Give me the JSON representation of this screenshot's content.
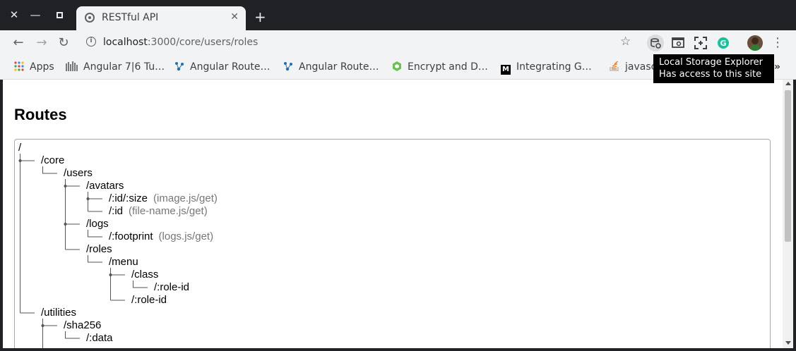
{
  "browser": {
    "window_controls": [
      "close",
      "minimize",
      "maximize"
    ],
    "tab": {
      "title": "RESTful API",
      "close_icon": "close-icon"
    },
    "url": {
      "host": "localhost",
      "rest": ":3000/core/users/roles"
    },
    "extensions": [
      "local-storage-explorer-icon",
      "cast-icon",
      "screenshot-icon",
      "grammarly-icon",
      "profile-avatar"
    ]
  },
  "bookmarks": [
    {
      "label": "Apps",
      "icon": "apps-grid-icon"
    },
    {
      "label": "Angular 7|6 Tu…",
      "icon": "bars-icon"
    },
    {
      "label": "Angular Route…",
      "icon": "route-icon"
    },
    {
      "label": "Angular Route…",
      "icon": "route-icon"
    },
    {
      "label": "Encrypt and D…",
      "icon": "node-hex-icon"
    },
    {
      "label": "Integrating G…",
      "icon": "medium-icon"
    },
    {
      "label": "javasc",
      "icon": "stackoverflow-icon"
    }
  ],
  "bookmarks_overflow": "»",
  "tooltip": {
    "line1": "Local Storage Explorer",
    "line2": "Has access to this site"
  },
  "page": {
    "heading": "Routes"
  },
  "routes": [
    {
      "path": "/",
      "handler": ""
    },
    {
      "path": "/core",
      "handler": ""
    },
    {
      "path": "/users",
      "handler": ""
    },
    {
      "path": "/avatars",
      "handler": ""
    },
    {
      "path": "/:id/:size",
      "handler": "(image.js/get)"
    },
    {
      "path": "/:id",
      "handler": "(file-name.js/get)"
    },
    {
      "path": "/logs",
      "handler": ""
    },
    {
      "path": "/:footprint",
      "handler": "(logs.js/get)"
    },
    {
      "path": "/roles",
      "handler": ""
    },
    {
      "path": "/menu",
      "handler": ""
    },
    {
      "path": "/class",
      "handler": ""
    },
    {
      "path": "/:role-id",
      "handler": ""
    },
    {
      "path": "/:role-id",
      "handler": ""
    },
    {
      "path": "/utilities",
      "handler": ""
    },
    {
      "path": "/sha256",
      "handler": ""
    },
    {
      "path": "/:data",
      "handler": ""
    }
  ]
}
